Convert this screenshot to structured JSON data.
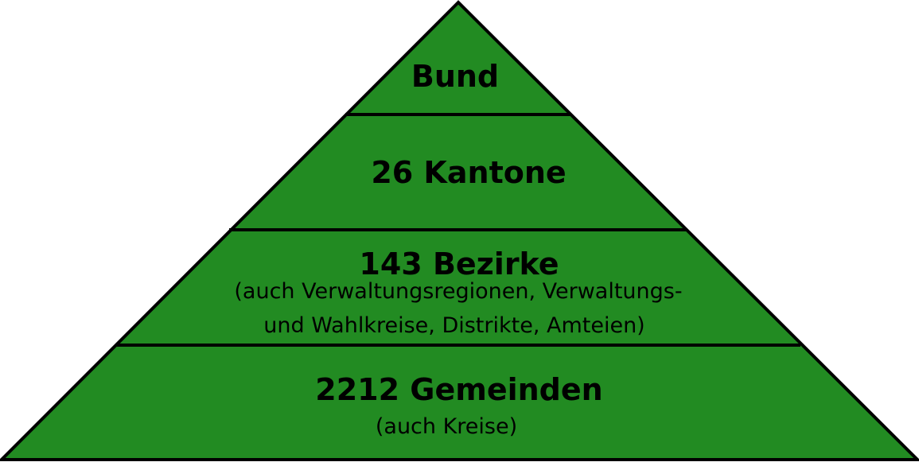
{
  "diagram": {
    "fill_color": "#228b22",
    "stroke_color": "#000000",
    "levels": [
      {
        "title": "Bund",
        "subtitle": []
      },
      {
        "title": "26 Kantone",
        "subtitle": []
      },
      {
        "title": "143 Bezirke",
        "subtitle": [
          "(auch Verwaltungsregionen, Verwaltungs-",
          "und Wahlkreise, Distrikte, Amteien)"
        ]
      },
      {
        "title": "2212 Gemeinden",
        "subtitle": [
          "(auch Kreise)"
        ]
      }
    ]
  }
}
